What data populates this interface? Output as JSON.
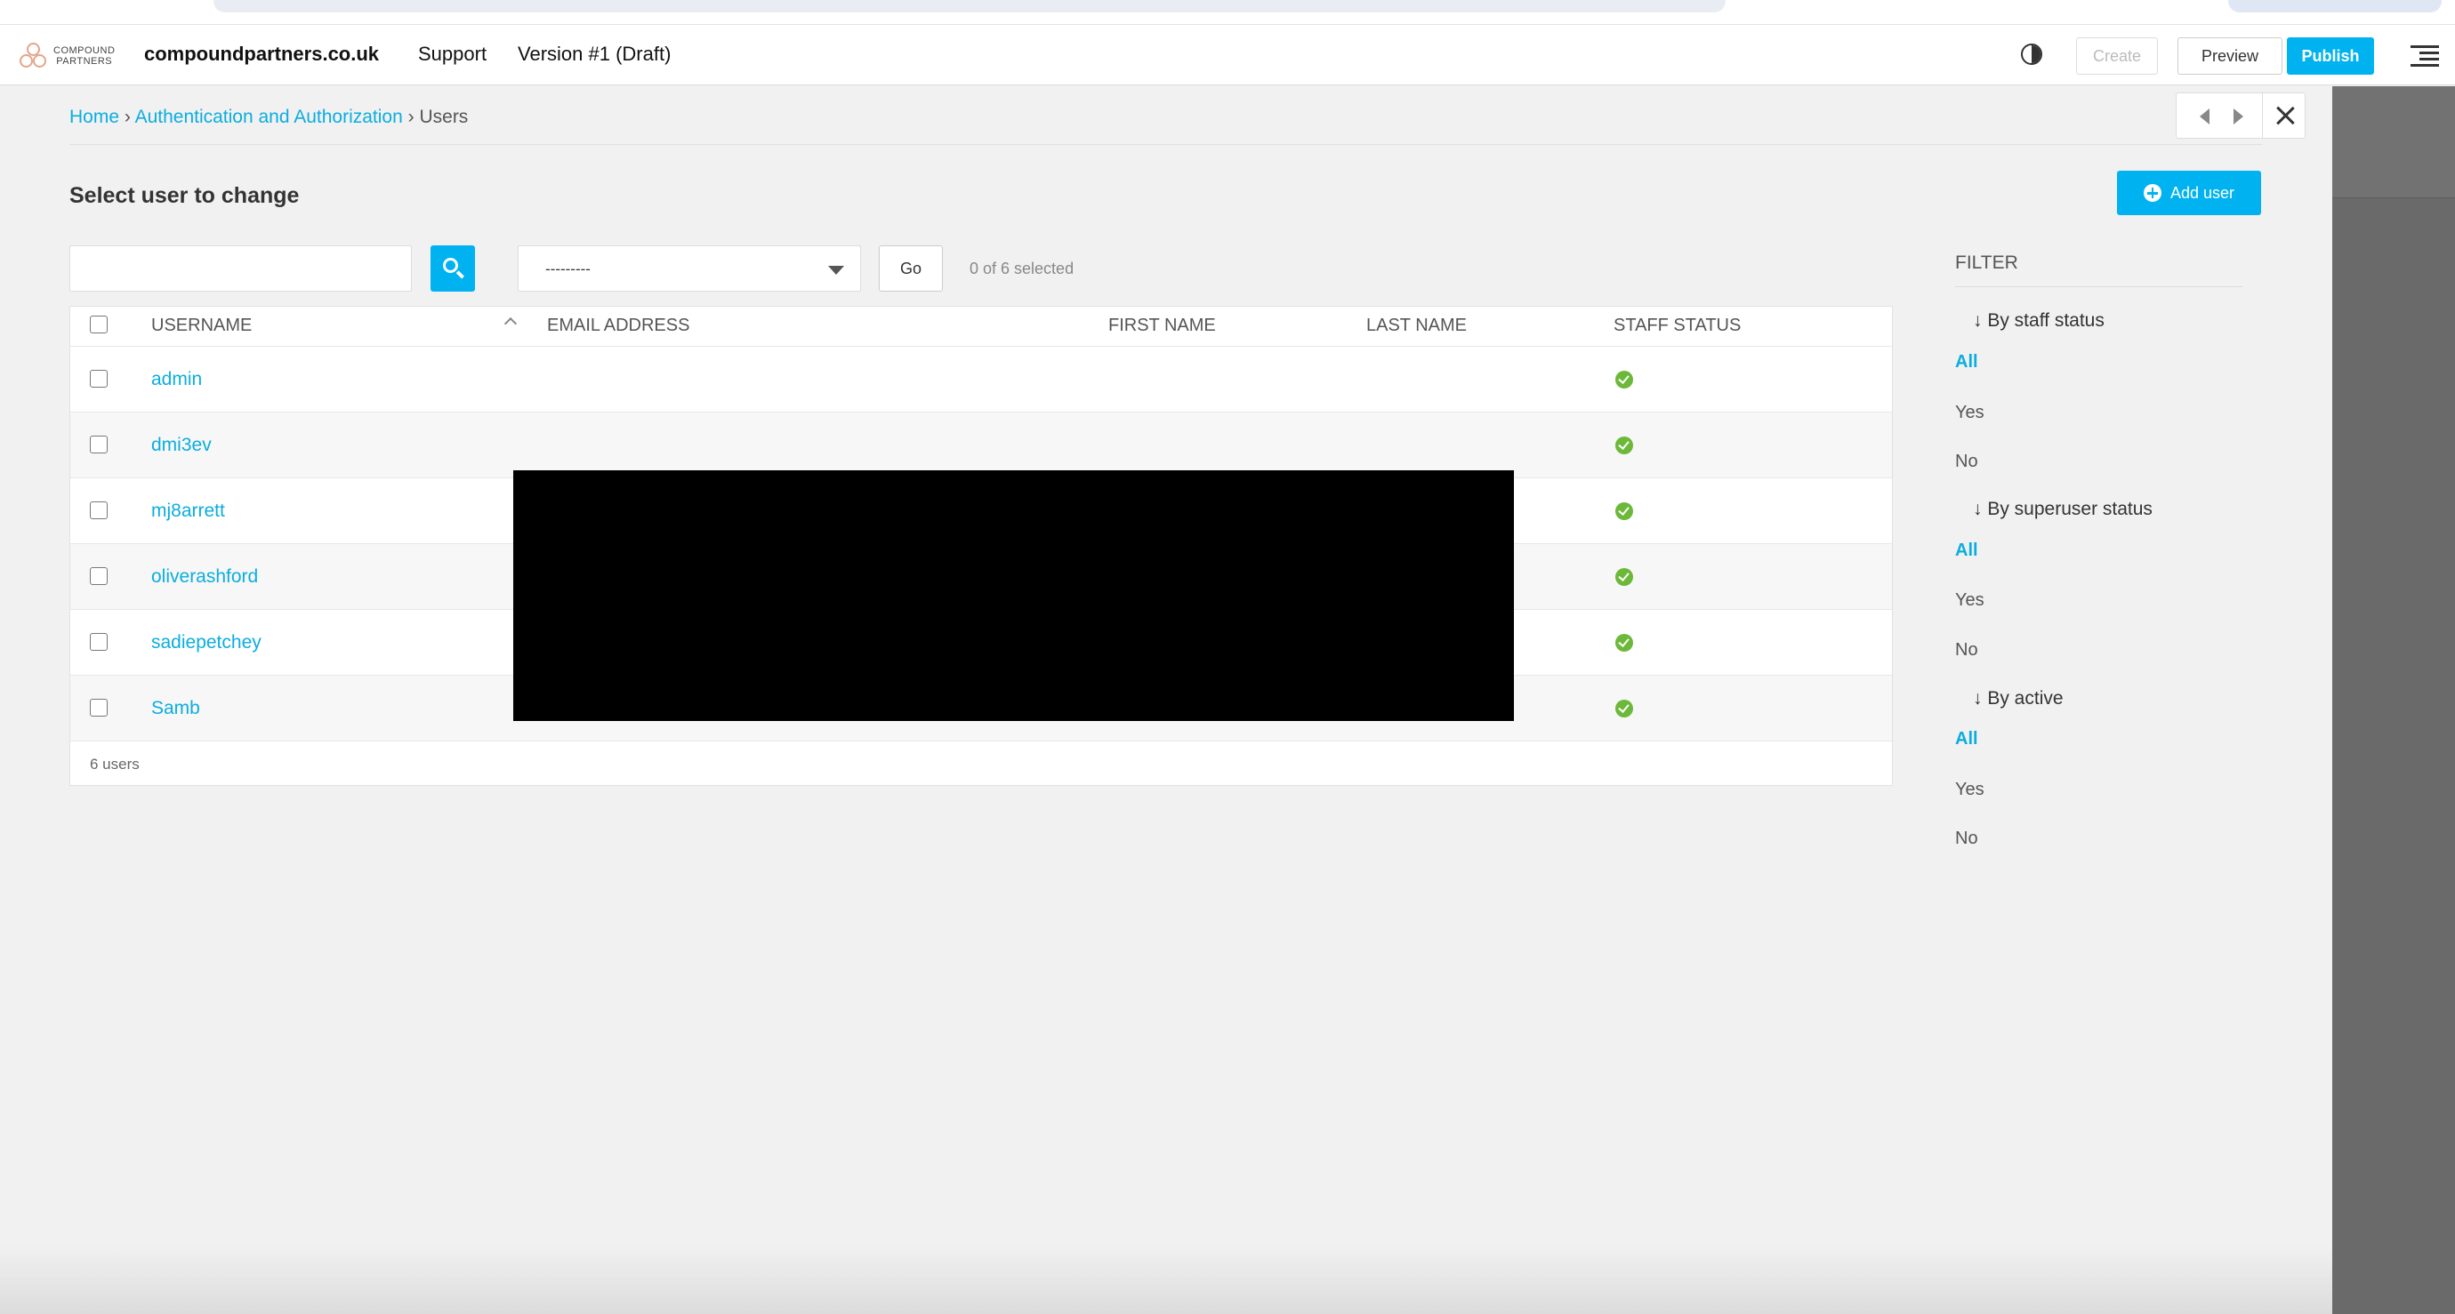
{
  "toolbar": {
    "logo_text_1": "COMPOUND",
    "logo_text_2": "PARTNERS",
    "site": "compoundpartners.co.uk",
    "support": "Support",
    "version": "Version #1 (Draft)",
    "create": "Create",
    "preview": "Preview",
    "publish": "Publish"
  },
  "breadcrumb": {
    "home": "Home",
    "section": "Authentication and Authorization",
    "current": "Users",
    "sep": "›"
  },
  "page": {
    "title": "Select user to change",
    "add_user": "Add user"
  },
  "actions": {
    "select_value": "---------",
    "go": "Go",
    "selected": "0 of 6 selected"
  },
  "table": {
    "headers": [
      "USERNAME",
      "EMAIL ADDRESS",
      "FIRST NAME",
      "LAST NAME",
      "STAFF STATUS"
    ],
    "rows": [
      {
        "username": "admin",
        "staff": true
      },
      {
        "username": "dmi3ev",
        "staff": true
      },
      {
        "username": "mj8arrett",
        "staff": true
      },
      {
        "username": "oliverashford",
        "staff": true
      },
      {
        "username": "sadiepetchey",
        "staff": true
      },
      {
        "username": "Samb",
        "staff": true
      }
    ],
    "footer": "6 users"
  },
  "filter": {
    "title": "FILTER",
    "groups": [
      {
        "label": "↓ By staff status",
        "options": [
          "All",
          "Yes",
          "No"
        ]
      },
      {
        "label": "↓ By superuser status",
        "options": [
          "All",
          "Yes",
          "No"
        ]
      },
      {
        "label": "↓ By active",
        "options": [
          "All",
          "Yes",
          "No"
        ]
      }
    ]
  },
  "colors": {
    "accent": "#00b3f0",
    "link": "#0bade0",
    "success": "#6cb93a"
  }
}
